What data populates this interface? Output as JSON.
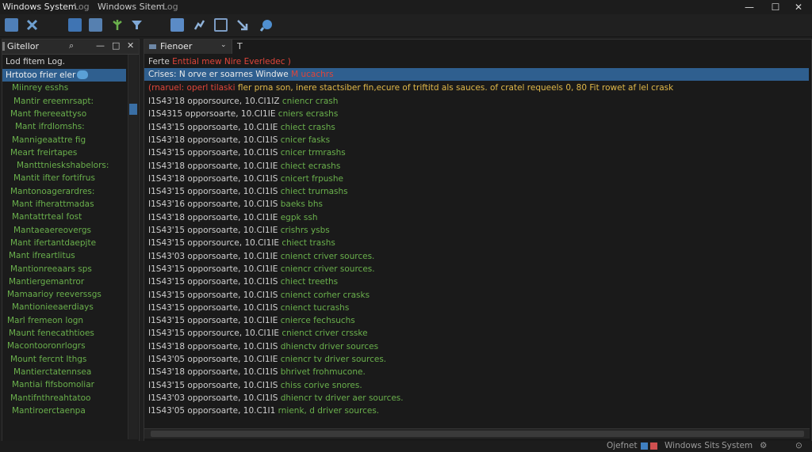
{
  "window": {
    "title": "Windows System",
    "title_part2": "Log",
    "title_center": "Windows Sitem",
    "title_center_suffix": "Log",
    "controls": [
      "—",
      "☐",
      "✕"
    ]
  },
  "toolbar": {
    "icons": [
      "folder-icon",
      "close-x-icon",
      "monitor-icon",
      "save-icon",
      "tree-icon",
      "filter-icon",
      "settings-icon",
      "chart-icon",
      "search-icon"
    ]
  },
  "left_panel": {
    "title": "Gitellor",
    "tree_header": "Lod fitem Log.",
    "selected_item": "Hrtotoo frier eler",
    "tree_items": [
      "Hrtotoo frier eler",
      "Miinrey esshs",
      "Mantir ereemrsapt:",
      "Mant fhereeattyso",
      "Mant ifrdlomshs:",
      "Mannigeaattre fig",
      "Meart freirtapes",
      "Mantttnieskshabelors:",
      "Mantit ifter fortifrus",
      "Mantonoagerardres:",
      "Mant ifherattmadas",
      "Mantattrteal fost",
      "Mantaeaereovergs",
      "Mant ifertantdaepjte",
      "Mant ifreartlitus",
      "Mantionreeaars sps",
      "Mantiergemantror",
      "Mamaarioy reeverssgs",
      "Mantionieeaerdiays",
      "Marl fremeon logn",
      "Maunt fenecathtioes",
      "Macontooronrlogrs",
      "Mount fercnt Ithgs",
      "Mantierctatennsea",
      "Mantiai fifsbomoliar",
      "Mantifnthreahtatoo",
      "Mantiroerctaenpa"
    ]
  },
  "log_panel": {
    "tab_label": "Fienoer",
    "tab_plus": "T",
    "header_prefix": "Ferte",
    "header_highlight": "Enttial mew Nire Everledec )",
    "selected_prefix": "Crises: N orve er soarnes Windwe",
    "selected_highlight": "M ucachrs",
    "error_prefix": "(rnaruel: operl tilaski",
    "error_body": "fler prna son, inere stactsiber fin,ecure of triftitd als sauces.  of cratel requeels  0, 80 Fit rowet af lel crask",
    "rows": [
      {
        "id": "I1S43'18",
        "text": "opporsource, 10.CI1IZ",
        "tag": "cniencr crash"
      },
      {
        "id": "I1S4315",
        "text": "opporsoarte, 10.CI1IE",
        "tag": "cniers ecrashs"
      },
      {
        "id": "I1S43'15",
        "text": "opporsoarte, 10.CI1IE",
        "tag": "chiect crashs"
      },
      {
        "id": "I1S43'18",
        "text": "opporsoarte, 10.CI1IS",
        "tag": "cnicer fasks"
      },
      {
        "id": "I1S43'15",
        "text": "opporsoarte, 10.CI1IS",
        "tag": "cnicer trmrashs"
      },
      {
        "id": "I1S43'18",
        "text": "opporsoarte, 10.CI1IE",
        "tag": "chiect ecrashs"
      },
      {
        "id": "I1S43'18",
        "text": "opporsoarte, 10.CI1IS",
        "tag": "cnicert frpushe"
      },
      {
        "id": "I1S43'15",
        "text": "opporsoarte, 10.CI1IS",
        "tag": "chiect trurnashs"
      },
      {
        "id": "I1S43'16",
        "text": "opporsoarte, 10.CI1IS",
        "tag": "baeks bhs"
      },
      {
        "id": "I1S43'18",
        "text": "opporsoarte, 10.CI1IE",
        "tag": "egpk ssh"
      },
      {
        "id": "I1S43'15",
        "text": "opporsoarte, 10.CI1IE",
        "tag": "crishrs ysbs"
      },
      {
        "id": "I1S43'15",
        "text": "opporsource, 10.CI1IE",
        "tag": "chiect trashs"
      },
      {
        "id": "I1S43'03",
        "text": "opporsoarte, 10.CI1IE",
        "tag": "cnienct criver sources."
      },
      {
        "id": "I1S43'15",
        "text": "opporsoarte, 10.CI1IE",
        "tag": "cniencr criver sources."
      },
      {
        "id": "I1S43'15",
        "text": "opporsoarte, 10.CI1IS",
        "tag": "chiect treeths"
      },
      {
        "id": "I1S43'15",
        "text": "opporsoarte, 10.CI1IS",
        "tag": "cnienct corher crasks"
      },
      {
        "id": "I1S43'15",
        "text": "opporsoarte, 10.CI1IS",
        "tag": "cnienct tucrashs"
      },
      {
        "id": "I1S43'15",
        "text": "opporsoarte, 10.CI1IE",
        "tag": "cnierce fechsuchs"
      },
      {
        "id": "I1S43'15",
        "text": "opporsource, 10.CI1IE",
        "tag": "cnienct criver crsske"
      },
      {
        "id": "I1S43'18",
        "text": "opporsoarte, 10.CI1IS",
        "tag": "dhienctv driver sources"
      },
      {
        "id": "I1S43'05",
        "text": "opporsoarte, 10.CI1IE",
        "tag": "cniencr tv driver sources."
      },
      {
        "id": "I1S43'18",
        "text": "opporsoarte, 10.CI1IS",
        "tag": "bhrivet frohmucone."
      },
      {
        "id": "I1S43'15",
        "text": "opporsoarte, 10.CI1IS",
        "tag": "chiss corive snores."
      },
      {
        "id": "I1S43'03",
        "text": "opporsoarte, 10.CI1IS",
        "tag": "dhiencr tv driver aer sources."
      },
      {
        "id": "I1S43'05",
        "text": "opporsoarte, 10.C1I1",
        "tag": "rnienk, d driver sources."
      }
    ]
  },
  "status_bar": {
    "left": "Ojefnet",
    "app_name": "Windows Sits",
    "app_suffix": "System"
  },
  "colors": {
    "accent": "#2f5f8f",
    "tree_text": "#6ab04c",
    "error": "#e0453a",
    "warning": "#e0b84a",
    "background": "#1f1f1f"
  }
}
